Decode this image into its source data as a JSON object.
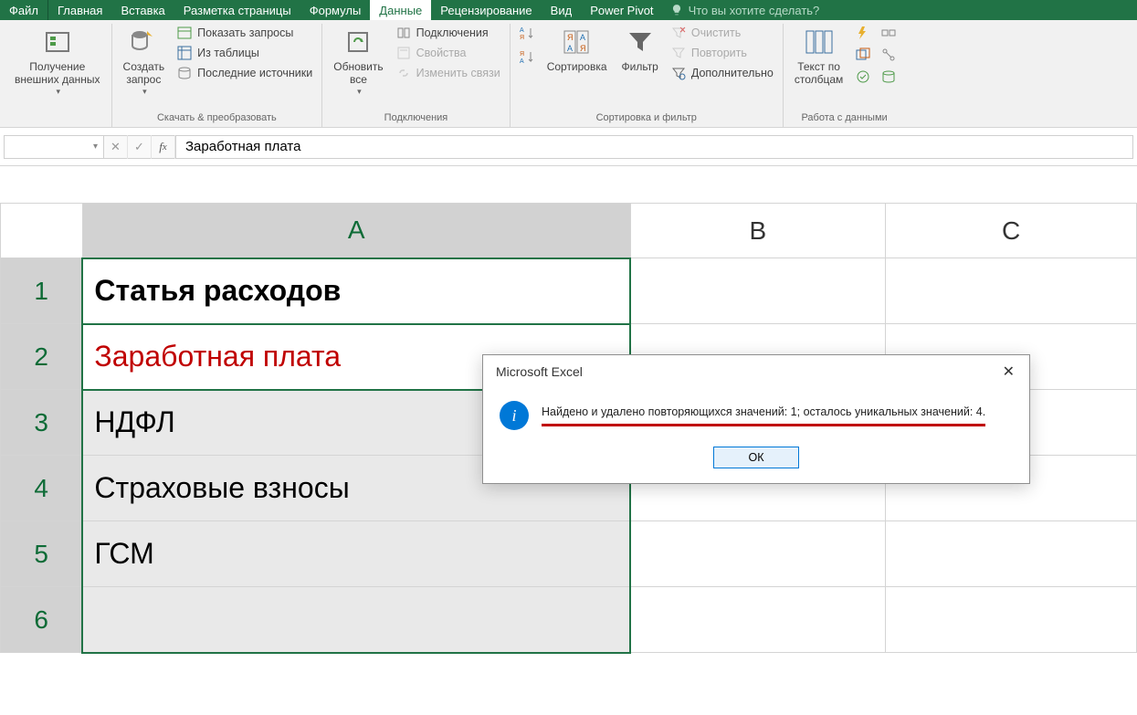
{
  "menu": {
    "tabs": [
      "Файл",
      "Главная",
      "Вставка",
      "Разметка страницы",
      "Формулы",
      "Данные",
      "Рецензирование",
      "Вид",
      "Power Pivot"
    ],
    "active": "Данные",
    "tell_me": "Что вы хотите сделать?"
  },
  "ribbon": {
    "groups": [
      {
        "label": "",
        "big": [
          {
            "label": "Получение\nвнешних данных",
            "dd": true
          }
        ]
      },
      {
        "label": "Скачать & преобразовать",
        "big": [
          {
            "label": "Создать\nзапрос",
            "dd": true
          }
        ],
        "small": [
          "Показать запросы",
          "Из таблицы",
          "Последние источники"
        ]
      },
      {
        "label": "Подключения",
        "big": [
          {
            "label": "Обновить\nвсе",
            "dd": true
          }
        ],
        "small": [
          "Подключения",
          "Свойства",
          "Изменить связи"
        ]
      },
      {
        "label": "Сортировка и фильтр",
        "big": [
          {
            "label": "Сортировка"
          },
          {
            "label": "Фильтр"
          }
        ],
        "sortbtns": [
          "А↓Я",
          "Я↓А"
        ],
        "small": [
          "Очистить",
          "Повторить",
          "Дополнительно"
        ]
      },
      {
        "label": "Работа с данными",
        "big": [
          {
            "label": "Текст по\nстолбцам"
          }
        ]
      }
    ]
  },
  "formula_bar": {
    "name_box": "",
    "value": "Заработная плата"
  },
  "sheet": {
    "columns": [
      "A",
      "B",
      "C"
    ],
    "rows": [
      {
        "n": "1",
        "A": "Статья расходов",
        "bold": true
      },
      {
        "n": "2",
        "A": "Заработная плата",
        "red": true,
        "active": true
      },
      {
        "n": "3",
        "A": "НДФЛ"
      },
      {
        "n": "4",
        "A": "Страховые взносы"
      },
      {
        "n": "5",
        "A": "ГСМ"
      },
      {
        "n": "6",
        "A": ""
      }
    ]
  },
  "dialog": {
    "title": "Microsoft Excel",
    "message": "Найдено и удалено повторяющихся значений: 1; осталось уникальных значений: 4.",
    "ok": "ОК"
  }
}
